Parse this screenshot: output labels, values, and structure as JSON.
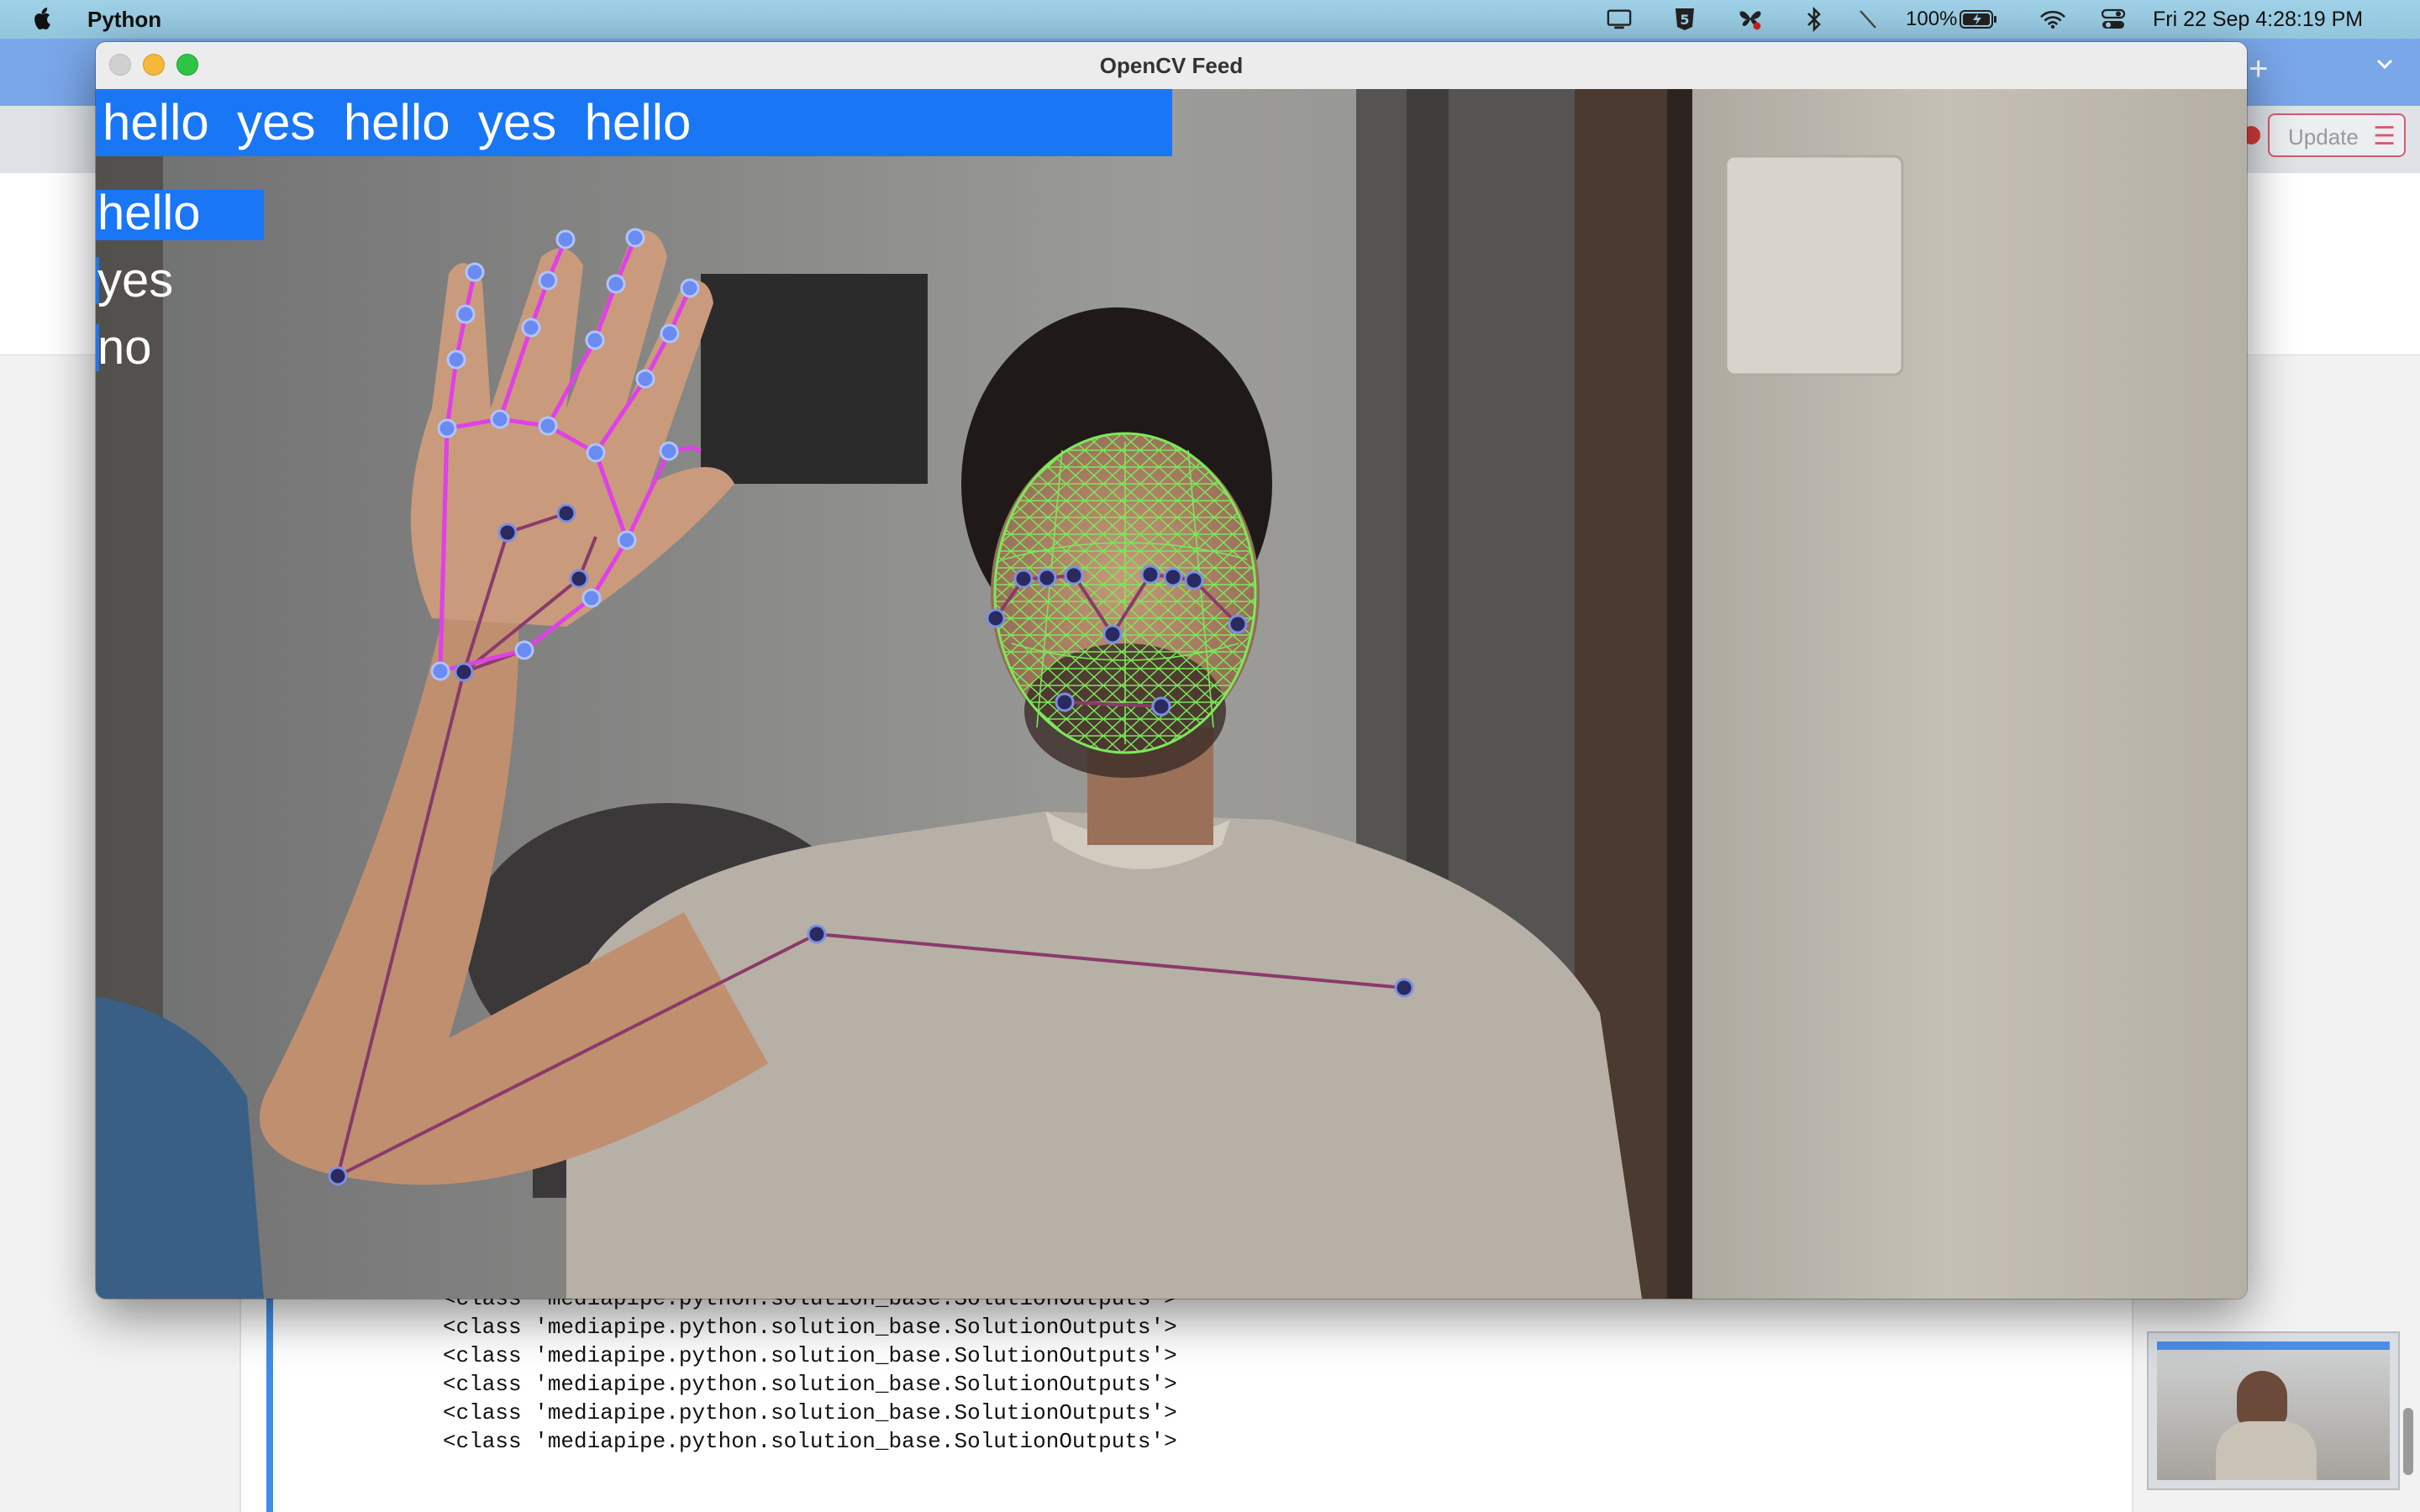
{
  "menubar": {
    "app_name": "Python",
    "battery": "100%",
    "datetime": "Fri 22 Sep  4:28:19 PM",
    "icons": [
      "apple-icon",
      "display-icon",
      "s5-icon",
      "butterfly-icon",
      "bluetooth-icon",
      "mute-icon",
      "battery-icon",
      "wifi-icon",
      "control-center-icon"
    ]
  },
  "window": {
    "title": "OpenCV Feed"
  },
  "overlay": {
    "sentence": "hello  yes  hello  yes  hello",
    "actions": [
      "hello",
      "yes",
      "no"
    ],
    "colors": {
      "banner": "#1976f5",
      "face_mesh": "#7ce85a",
      "pose_line": "#8a3a6a",
      "hand_line": "#e040e8"
    }
  },
  "background_app": {
    "update_button": "Update",
    "tab_plus": "+",
    "output_lines": [
      "<class 'mediapipe.python.solution_base.SolutionOutputs'>",
      "<class 'mediapipe.python.solution_base.SolutionOutputs'>",
      "<class 'mediapipe.python.solution_base.SolutionOutputs'>",
      "<class 'mediapipe.python.solution_base.SolutionOutputs'>",
      "<class 'mediapipe.python.solution_base.SolutionOutputs'>",
      "<class 'mediapipe.python.solution_base.SolutionOutputs'>",
      "<class 'mediapipe.python.solution_base.SolutionOutputs'>"
    ]
  }
}
